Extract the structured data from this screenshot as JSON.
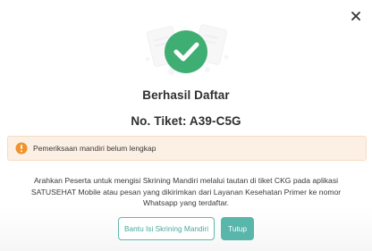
{
  "modal": {
    "title": "Berhasil Daftar",
    "ticket": "No. Tiket: A39-C5G",
    "warning": "Pemeriksaan mandiri belum lengkap",
    "description": "Arahkan Peserta untuk mengisi Skrining Mandiri melalui tautan di tiket CKG pada aplikasi SATUSEHAT Mobile atau pesan yang dikirimkan dari Layanan Kesehatan Primer ke nomor Whatsapp yang terdaftar.",
    "buttons": {
      "assist": "Bantu Isi Skrining Mandiri",
      "close": "Tutup"
    },
    "icons": {
      "close": "close-icon",
      "success": "check-circle-icon",
      "warning": "warning-circle-icon"
    }
  },
  "colors": {
    "success": "#3fae72",
    "accent": "#58b6ab",
    "warning": "#f0932a",
    "warning_bg": "#fcefe3"
  }
}
